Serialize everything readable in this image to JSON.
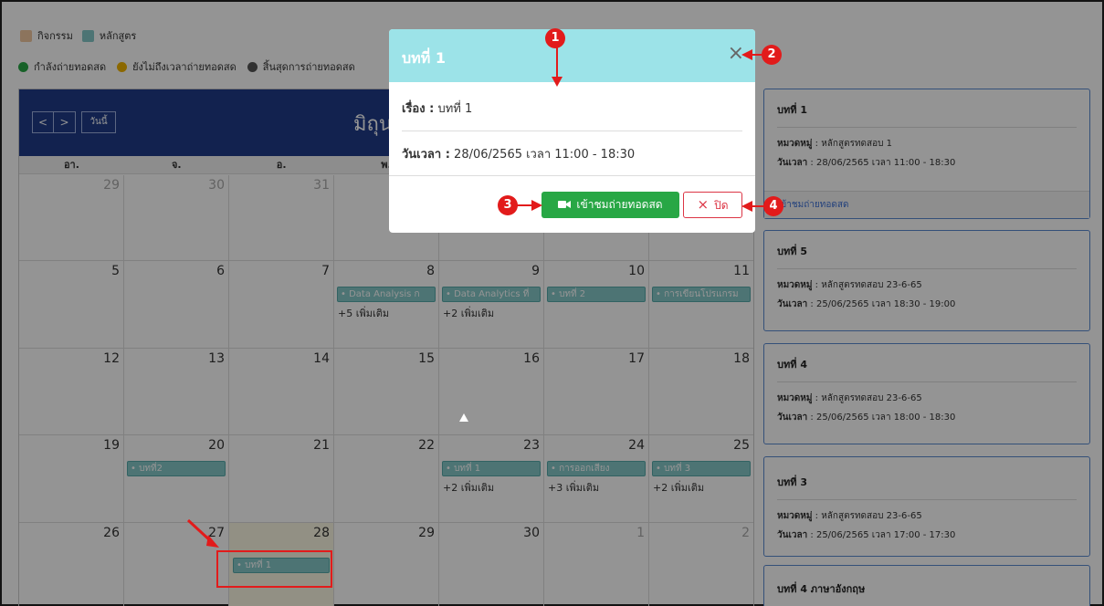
{
  "legend_types": [
    {
      "label": "กิจกรรม",
      "color": "#f2c9a0"
    },
    {
      "label": "หลักสูตร",
      "color": "#86c9c9"
    }
  ],
  "legend_status": [
    {
      "label": "กำลังถ่ายทอดสด",
      "color": "#28a745"
    },
    {
      "label": "ยังไม่ถึงเวลาถ่ายทอดสด",
      "color": "#f0b400"
    },
    {
      "label": "สิ้นสุดการถ่ายทอดสด",
      "color": "#555555"
    }
  ],
  "calendar": {
    "prev_label": "<",
    "next_label": ">",
    "today_label": "วันนี้",
    "month_title": "มิถุนาย",
    "weekdays": [
      "อา.",
      "จ.",
      "อ.",
      "พ.",
      "",
      "",
      ""
    ],
    "weeks": [
      [
        "29",
        "30",
        "31",
        "",
        "",
        "",
        ""
      ],
      [
        "5",
        "6",
        "7",
        "8",
        "9",
        "10",
        "11"
      ],
      [
        "12",
        "13",
        "14",
        "15",
        "16",
        "17",
        "18"
      ],
      [
        "19",
        "20",
        "21",
        "22",
        "23",
        "24",
        "25"
      ],
      [
        "26",
        "27",
        "28",
        "29",
        "30",
        "1",
        "2"
      ]
    ],
    "events": {
      "w2d3": "• Data Analysis ก",
      "w2d4": "• Data Analytics ที่",
      "w2d5": "• บทที่ 2",
      "w2d6": "• การเขียนโปรแกรม",
      "w2d3_more": "+5 เพิ่มเติม",
      "w2d4_more": "+2 เพิ่มเติม",
      "w4d1": "• บทที่2",
      "w4d4": "• บทที่ 1",
      "w4d5": "• การออกเสียง",
      "w4d6": "• บทที่ 3",
      "w4d4_more": "+2 เพิ่มเติม",
      "w4d5_more": "+3 เพิ่มเติม",
      "w4d6_more": "+2 เพิ่มเติม",
      "w5d2": "• บทที่ 1"
    }
  },
  "side_cards": [
    {
      "title": "บทที่ 1",
      "category_label": "หมวดหมู่",
      "category": " : หลักสูตรทดสอบ 1",
      "time_label": "วันเวลา",
      "time": " : 28/06/2565 เวลา 11:00 - 18:30",
      "footer": "เข้าชมถ่ายทอดสด"
    },
    {
      "title": "บทที่ 5",
      "category_label": "หมวดหมู่",
      "category": " : หลักสูตรทดสอบ 23-6-65",
      "time_label": "วันเวลา",
      "time": " : 25/06/2565 เวลา 18:30 - 19:00"
    },
    {
      "title": "บทที่ 4",
      "category_label": "หมวดหมู่",
      "category": " : หลักสูตรทดสอบ 23-6-65",
      "time_label": "วันเวลา",
      "time": " : 25/06/2565 เวลา 18:00 - 18:30"
    },
    {
      "title": "บทที่ 3",
      "category_label": "หมวดหมู่",
      "category": " : หลักสูตรทดสอบ 23-6-65",
      "time_label": "วันเวลา",
      "time": " : 25/06/2565 เวลา 17:00 - 17:30"
    },
    {
      "title": "บทที่ 4 ภาษาอังกฤษ"
    }
  ],
  "modal": {
    "title": "บทที่ 1",
    "close_symbol": "×",
    "subject_label": "เรื่อง :",
    "subject": " บทที่ 1",
    "datetime_label": "วันเวลา :",
    "datetime": " 28/06/2565 เวลา 11:00 - 18:30",
    "join_label": "เข้าชมถ่ายทอดสด",
    "close_label": "ปิด",
    "close_btn_icon": "×"
  },
  "annotations": [
    "1",
    "2",
    "3",
    "4"
  ],
  "colors": {
    "header": "#1f3c88",
    "modal_header": "#9ce3e8",
    "join": "#28a745",
    "close": "#dc3545",
    "annotation": "#e21b1b",
    "event": "#86c9c9"
  }
}
